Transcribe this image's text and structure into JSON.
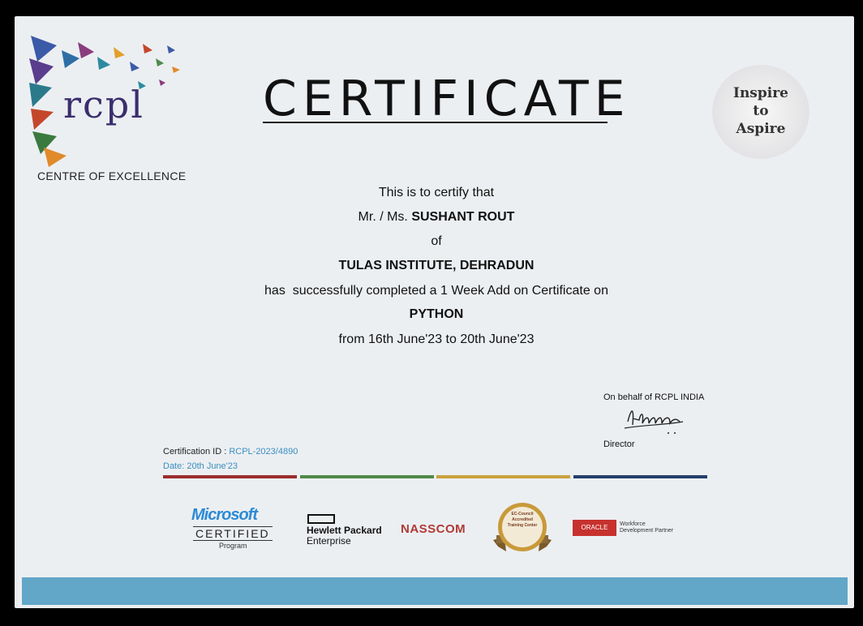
{
  "logo": {
    "text": "rcpl",
    "tagline": "CENTRE OF EXCELLENCE"
  },
  "badge": {
    "lines": [
      "Inspire",
      "to",
      "Aspire"
    ]
  },
  "title": "CERTIFICATE",
  "body": {
    "line1": "This is to certify that",
    "salutation": "Mr. / Ms.",
    "name": "SUSHANT ROUT",
    "of": "of",
    "institute": "TULAS INSTITUTE, DEHRADUN",
    "completed": "has  successfully completed a 1 Week Add on Certificate on",
    "course": "PYTHON",
    "dates": "from 16th June'23 to 20th June'23"
  },
  "signature": {
    "behalf": "On behalf of RCPL INDIA",
    "role": "Director"
  },
  "cert": {
    "id_label": "Certification ID :",
    "id_value": "RCPL-2023/4890",
    "date": "Date: 20th June'23"
  },
  "bars": {
    "colors": [
      "#9b2d2e",
      "#4f8a4a",
      "#c9a23f",
      "#25406b"
    ]
  },
  "partners": {
    "microsoft": {
      "name": "Microsoft",
      "certified": "CERTIFIED",
      "program": "Program"
    },
    "hpe": {
      "line1": "Hewlett Packard",
      "line2": "Enterprise"
    },
    "nasscom": "NASSCOM",
    "eccouncil": {
      "line1": "EC-Council",
      "line2": "Accredited",
      "line3": "Training Center"
    },
    "oracle": {
      "name": "ORACLE",
      "line1": "Workforce",
      "line2": "Development Partner"
    }
  },
  "colors": {
    "accent_blue": "#62a6c8",
    "link_blue": "#3a8fc0"
  }
}
